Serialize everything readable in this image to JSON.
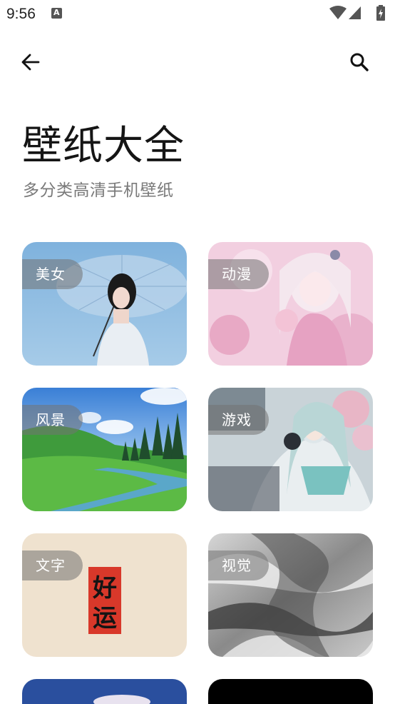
{
  "status_bar": {
    "time": "9:56"
  },
  "header": {
    "title": "壁纸大全",
    "subtitle": "多分类高清手机壁纸"
  },
  "categories": [
    {
      "label": "美女"
    },
    {
      "label": "动漫"
    },
    {
      "label": "风景"
    },
    {
      "label": "游戏"
    },
    {
      "label": "文字"
    },
    {
      "label": "视觉"
    }
  ],
  "text_card_art": {
    "line1": "好",
    "line2": "运"
  },
  "colors": {
    "accent_text": "#151515",
    "subtitle": "#7a7a7a",
    "label_bg": "rgba(115,115,115,0.55)"
  },
  "icons": [
    "back-arrow-icon",
    "search-icon",
    "wifi-icon",
    "cell-signal-icon",
    "battery-charging-icon",
    "notification-a-icon"
  ]
}
